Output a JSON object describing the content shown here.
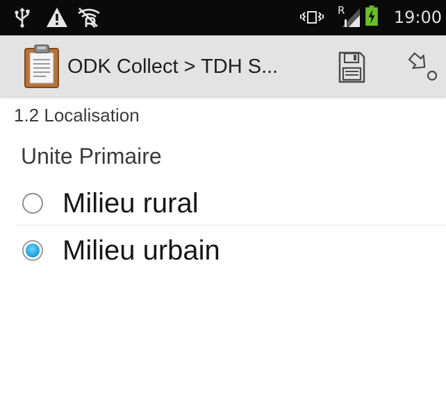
{
  "status_bar": {
    "time": "19:00",
    "network_label": "R",
    "icons": [
      "usb-icon",
      "warning-icon",
      "wifi-disabled-icon",
      "vibrate-icon",
      "signal-icon",
      "battery-charging-icon"
    ]
  },
  "action_bar": {
    "title": "ODK Collect > TDH S...",
    "app_icon": "clipboard-icon",
    "save_icon": "save-icon",
    "hierarchy_icon": "form-hierarchy-icon"
  },
  "form": {
    "group_label": "1.2 Localisation",
    "question_label": "Unite Primaire",
    "options": [
      {
        "label": "Milieu rural",
        "selected": false
      },
      {
        "label": "Milieu urbain",
        "selected": true
      }
    ]
  },
  "colors": {
    "status_bar_bg": "#0a0a0a",
    "action_bar_bg": "#e3e3e3",
    "radio_selected": "#1ea6df",
    "battery_green": "#6abf2a"
  }
}
